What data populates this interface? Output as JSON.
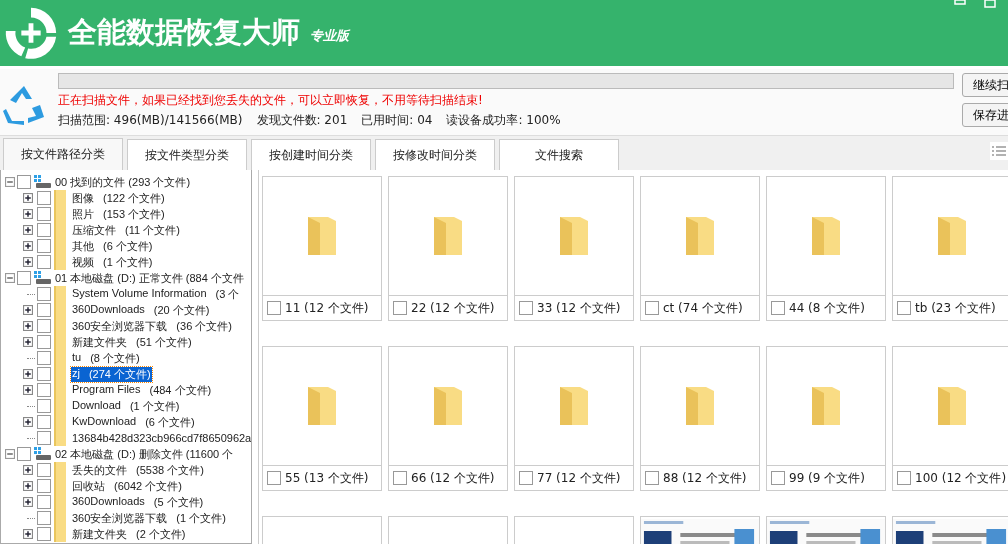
{
  "app": {
    "title": "全能数据恢复大师",
    "edition": "专业版"
  },
  "scan": {
    "level": 0.0,
    "message": "正在扫描文件，如果已经找到您丢失的文件，可以立即恢复，不用等待扫描结束!",
    "stats": [
      "扫描范围: 496(MB)/141566(MB)",
      "发现文件数: 201",
      "已用时间: 04",
      "读设备成功率: 100%"
    ]
  },
  "buttons": [
    "继续扫",
    "保存进"
  ],
  "tabs": [
    {
      "label": "按文件路径分类",
      "selected": true
    },
    {
      "label": "按文件类型分类",
      "selected": false
    },
    {
      "label": "按创建时间分类",
      "selected": false
    },
    {
      "label": "按修改时间分类",
      "selected": false
    },
    {
      "label": "文件搜索",
      "selected": false
    }
  ],
  "tree": [
    {
      "name": "00 找到的文件",
      "count": "(293 个文件)",
      "expandable": true,
      "expanded": true,
      "checked": false,
      "selected": false,
      "children": [
        {
          "name": "图像",
          "count": "(122 个文件)",
          "expandable": true,
          "expanded": false,
          "checked": false,
          "selected": false
        },
        {
          "name": "照片",
          "count": "(153 个文件)",
          "expandable": true,
          "expanded": false,
          "checked": false,
          "selected": false
        },
        {
          "name": "压缩文件",
          "count": "(11 个文件)",
          "expandable": true,
          "expanded": false,
          "checked": false,
          "selected": false
        },
        {
          "name": "其他",
          "count": "(6 个文件)",
          "expandable": true,
          "expanded": false,
          "checked": false,
          "selected": false
        },
        {
          "name": "视频",
          "count": "(1 个文件)",
          "expandable": true,
          "expanded": false,
          "checked": false,
          "selected": false
        }
      ]
    },
    {
      "name": "01 本地磁盘 (D:) 正常文件",
      "count": "(884 个文件",
      "expandable": true,
      "expanded": true,
      "checked": false,
      "selected": false,
      "children": [
        {
          "name": "System Volume Information",
          "count": "(3 个",
          "expandable": false,
          "expanded": false,
          "checked": false,
          "selected": false
        },
        {
          "name": "360Downloads",
          "count": "(20 个文件)",
          "expandable": true,
          "expanded": false,
          "checked": false,
          "selected": false
        },
        {
          "name": "360安全浏览器下载",
          "count": "(36 个文件)",
          "expandable": true,
          "expanded": false,
          "checked": false,
          "selected": false
        },
        {
          "name": "新建文件夹",
          "count": "(51 个文件)",
          "expandable": true,
          "expanded": false,
          "checked": false,
          "selected": false
        },
        {
          "name": "tu",
          "count": "(8 个文件)",
          "expandable": false,
          "expanded": false,
          "checked": false,
          "selected": false
        },
        {
          "name": "zj",
          "count": "(274 个文件)",
          "expandable": true,
          "expanded": false,
          "checked": false,
          "selected": true
        },
        {
          "name": "Program Files",
          "count": "(484 个文件)",
          "expandable": true,
          "expanded": false,
          "checked": false,
          "selected": false
        },
        {
          "name": "Download",
          "count": "(1 个文件)",
          "expandable": false,
          "expanded": false,
          "checked": false,
          "selected": false
        },
        {
          "name": "KwDownload",
          "count": "(6 个文件)",
          "expandable": true,
          "expanded": false,
          "checked": false,
          "selected": false
        },
        {
          "name": "13684b428d323cb966cd7f8650962a",
          "expandable": false,
          "expanded": false,
          "checked": false,
          "selected": false
        }
      ]
    },
    {
      "name": "02 本地磁盘 (D:) 删除文件",
      "count": "(11600 个",
      "expandable": true,
      "expanded": true,
      "checked": false,
      "selected": false,
      "children": [
        {
          "name": "丢失的文件",
          "count": "(5538 个文件)",
          "expandable": true,
          "expanded": false,
          "checked": false,
          "selected": false
        },
        {
          "name": "回收站",
          "count": "(6042 个文件)",
          "expandable": true,
          "expanded": false,
          "checked": false,
          "selected": false
        },
        {
          "name": "360Downloads",
          "count": "(5 个文件)",
          "expandable": true,
          "expanded": false,
          "checked": false,
          "selected": false
        },
        {
          "name": "360安全浏览器下载",
          "count": "(1 个文件)",
          "expandable": false,
          "expanded": false,
          "checked": false,
          "selected": false
        },
        {
          "name": "新建文件夹",
          "count": "(2 个文件)",
          "expandable": true,
          "expanded": false,
          "checked": false,
          "selected": false
        }
      ]
    }
  ],
  "files": [
    {
      "kind": "folder",
      "label": "11 (12 个文件)",
      "checked": false
    },
    {
      "kind": "folder",
      "label": "22 (12 个文件)",
      "checked": false
    },
    {
      "kind": "folder",
      "label": "33 (12 个文件)",
      "checked": false
    },
    {
      "kind": "folder",
      "label": "ct (74 个文件)",
      "checked": false
    },
    {
      "kind": "folder",
      "label": "44 (8 个文件)",
      "checked": false
    },
    {
      "kind": "folder",
      "label": "tb (23 个文件)",
      "checked": false
    },
    {
      "kind": "folder",
      "label": "55 (13 个文件)",
      "checked": false
    },
    {
      "kind": "folder",
      "label": "66 (12 个文件)",
      "checked": false
    },
    {
      "kind": "folder",
      "label": "77 (12 个文件)",
      "checked": false
    },
    {
      "kind": "folder",
      "label": "88 (12 个文件)",
      "checked": false
    },
    {
      "kind": "folder",
      "label": "99 (9 个文件)",
      "checked": false
    },
    {
      "kind": "folder",
      "label": "100 (12 个文件)",
      "checked": false
    },
    {
      "kind": "blank"
    },
    {
      "kind": "blank"
    },
    {
      "kind": "blank"
    },
    {
      "kind": "picture"
    },
    {
      "kind": "picture"
    },
    {
      "kind": "picture"
    }
  ]
}
